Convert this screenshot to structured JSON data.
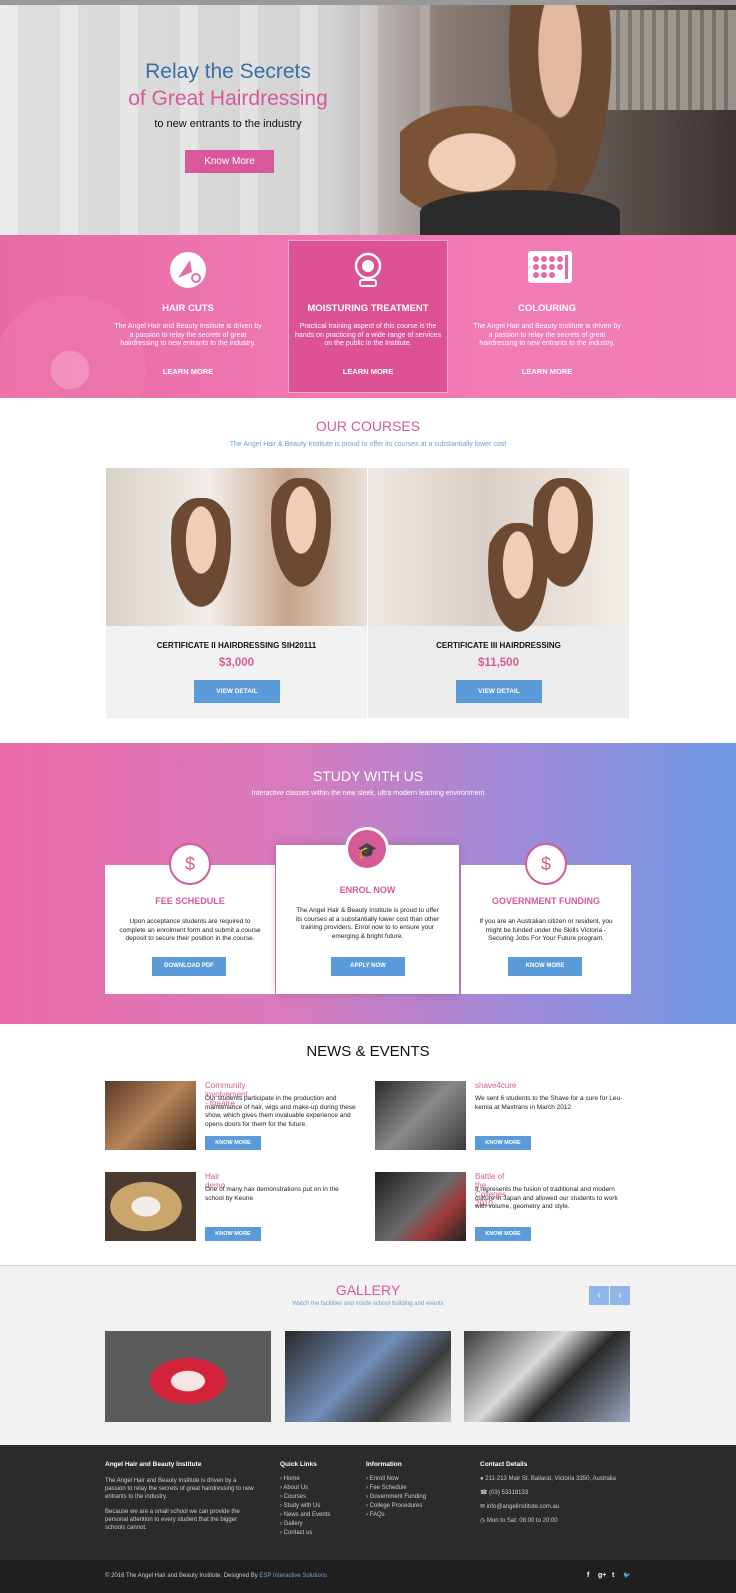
{
  "hero": {
    "title_line1": "Relay the Secrets",
    "title_line2": "of Great Hairdressing",
    "subtitle": "to new entrants to the industry",
    "button": "Know More"
  },
  "services": [
    {
      "icon": "haircut-icon",
      "title": "HAIR CUTS",
      "desc": "The Angel Hair and Beauty Institute is driven by a passion to relay the secrets of  great hairdressing to new entrants to the industry.",
      "link": "LEARN MORE"
    },
    {
      "icon": "mirror-icon",
      "title": "MOISTURING TREATMENT",
      "desc": "Practical training aspect of this course is the hands on practicing of a wide range of services on the public in the Institute.",
      "link": "LEARN MORE"
    },
    {
      "icon": "palette-icon",
      "title": "COLOURING",
      "desc": "The Angel Hair and Beauty Institute is driven by a passion to relay the secrets of  great hairdressing to new entrants to the industry.",
      "link": "LEARN MORE"
    }
  ],
  "courses": {
    "title": "OUR COURSES",
    "subtitle": "The Angel Hair & Beauty Institute is proud to offer its courses at a substantially lower cost",
    "items": [
      {
        "name": "CERTIFICATE II HAIRDRESSING SIH20111",
        "price": "$3,000",
        "button": "VIEW DETAIL"
      },
      {
        "name": "CERTIFICATE III HAIRDRESSING",
        "price": "$11,500",
        "button": "VIEW DETAIL"
      }
    ]
  },
  "study": {
    "title": "STUDY WITH US",
    "subtitle": "Interactive classes within the new sleek, ultra modern learning environment",
    "items": [
      {
        "title": "FEE SCHEDULE",
        "desc": "Upon acceptance students are required to complete an enrolment form and submit a course deposit to secure their position in the course.",
        "button": "DOWNLOAD PDF",
        "icon": "fee-icon",
        "glyph": "$"
      },
      {
        "title": "ENROL NOW",
        "desc": "The Angel Hair & Beauty Institute is proud to offer its courses at a substantially lower cost than other training providers. Enrol now to to ensure your emerging & bright future.",
        "button": "APPLY NOW",
        "icon": "graduation-cap-icon",
        "glyph": "🎓"
      },
      {
        "title": "GOVERNMENT FUNDING",
        "desc": "If you are an Australian citizen or resident, you might be funded under the Skills Victoria - Securing Jobs For Your Future program.",
        "button": "KNOW MORE",
        "icon": "funding-icon",
        "glyph": "$"
      }
    ]
  },
  "news": {
    "title": "NEWS & EVENTS",
    "items": [
      {
        "title": "Community involvement - theatre",
        "desc": "Our students participate in the production and maintenance of hair, wigs and make-up during these show, which gives them invaluable experience and opens doors for them for the future.",
        "button": "KNOW MORE"
      },
      {
        "title": "shave4cure",
        "desc": "We sent 6 students to the Shave for a cure for Leu-kemia at Maxtrans in March 2012",
        "button": "KNOW MORE"
      },
      {
        "title": "Hair demo",
        "desc": "One of many hair demonstrations put on in the school by Keune",
        "button": "KNOW MORE"
      },
      {
        "title": "Battle of the Colleges 2010",
        "desc": "It represents the fusion of traditional and modern culture in Japan and allowed our students to work with volume, geometry and style.",
        "button": "KNOW MORE"
      }
    ]
  },
  "gallery": {
    "title": "GALLERY",
    "subtitle": "Watch the facilities and inside school building and events",
    "prev": "‹",
    "next": "›"
  },
  "footer": {
    "about": {
      "title": "Angel Hair and Beauty Institute",
      "p1": "The Angel Hair and Beauty Institute is driven by a passion to relay the secrets of  great hairdressing to new entrants to the industry.",
      "p2": "Because we are a small school we can provide the personal attention to every student that the bigger schools cannot."
    },
    "quick": {
      "title": "Quick Links",
      "links": [
        "Home",
        "About Us",
        "Courses",
        "Study with Us",
        "News and Events",
        "Gallery",
        "Contact us"
      ]
    },
    "info": {
      "title": "Information",
      "links": [
        "Enroll Now",
        "Fee Schedule",
        "Government Funding",
        "College Procedures",
        "FAQs"
      ]
    },
    "contact": {
      "title": "Contact Details",
      "address": "211-213 Mair St. Ballarat, Victoria 3350, Australia",
      "phone": "(03) 53318133",
      "email": "info@angelinstitute.com.au",
      "hours": "Mon to Sat: 08:00  to  20:00"
    },
    "copyright": "© 2016 The Angel Hair and Beauty Institute. Designed By ",
    "designer": "ESP Interactive Solutions",
    "social": [
      "f",
      "g+",
      "t",
      "🐦"
    ]
  },
  "colors": {
    "pink": "#d45b98",
    "blue": "#5b9bd9",
    "dark": "#2b2b2b"
  }
}
